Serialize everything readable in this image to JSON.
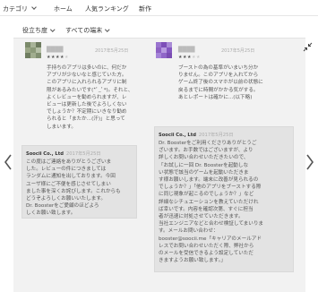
{
  "topnav": {
    "category_label": "カテゴリ",
    "home_label": "ホーム",
    "ranking_label": "人気ランキング",
    "new_label": "新作"
  },
  "filters": {
    "priority_label": "役立ち度",
    "device_label": "すべての端末"
  },
  "reviews": [
    {
      "author": "████",
      "date": "2017年5月25日",
      "rating": 4,
      "text": "手持ちのアプリは多いのに、何だか\nアプリが少ないなと感じていた方。\nこのアプリに入れられるアプリに制\n限があるみたいです(*ﾟ_ﾟ*)。それと、\nよくレビューを勧められますが、レ\nビューは更新した後でよろしくない\nでしょうか？不定期にいきなり勧め\nられると「またか...(汗)」と思って\nしまいます。"
    },
    {
      "author": "████",
      "date": "2017年5月25日",
      "rating": 3,
      "text": "ブーストの為の基準がいまいち分か\nりません。このアプリを入れてから\nゲーム終了後のスマホが以前の状態に\n戻るまでに時間がかかる気がする。\nあとレポートは確かに...(以下略)"
    }
  ],
  "replies": [
    {
      "developer": "Soocii Co., Ltd",
      "date": "2017年5月25日",
      "text": "この度はご連絡をありがとうございま\nした。レビューの件につきましては\nランダムに通知を出しております。今回\nユーザ様にご不便を感じさせてしまい\nました事を深くお詫びします。これからも\nどうぞよろしくお願いいたします。\nDr. Boosterをご愛顧のほどよろ\nしくお願い致します。"
    },
    {
      "developer": "Soocii Co., Ltd",
      "date": "2017年5月25日",
      "text": "Dr. Boosterをご利用くださりありがとうご\nざいます。お手数ではございますが、より\n詳しくお問い合わせいただきたいので、\n「お試しに一回 Dr. Boosterを起動しな\nい状態で該当のゲームを起動いただきま\nす様お願いします。端末に改善が見られるの\nでしょうか？」「他のアプリをブーストする際\nに同じ現象が起こるのでしょうか？」など\n詳細なシチュエーションを教えていただけれ\nば幸いです。内容を確認次第、すぐに担当\n者が迅速に対処させていただきます。\n当社エンジニアなどと合わせ検証してまいりま\nす。メールお問い合わせ：\nbooster@soocii.me「キャリアのメールアド\nレスでお問い合わせいただく際、弊社から\nのメールを受信できるよう設定していただ\nきますようお願い致します。」"
    }
  ],
  "colors": {
    "panel_bg": "#f2f2f2",
    "reply_bg": "#e3e3e3",
    "avatar1": "#8c9a7a",
    "avatar2": "#8e62c4"
  },
  "icons": {
    "expand": "compress-arrows-icon",
    "prev": "chevron-left-icon",
    "next": "chevron-right-icon"
  }
}
